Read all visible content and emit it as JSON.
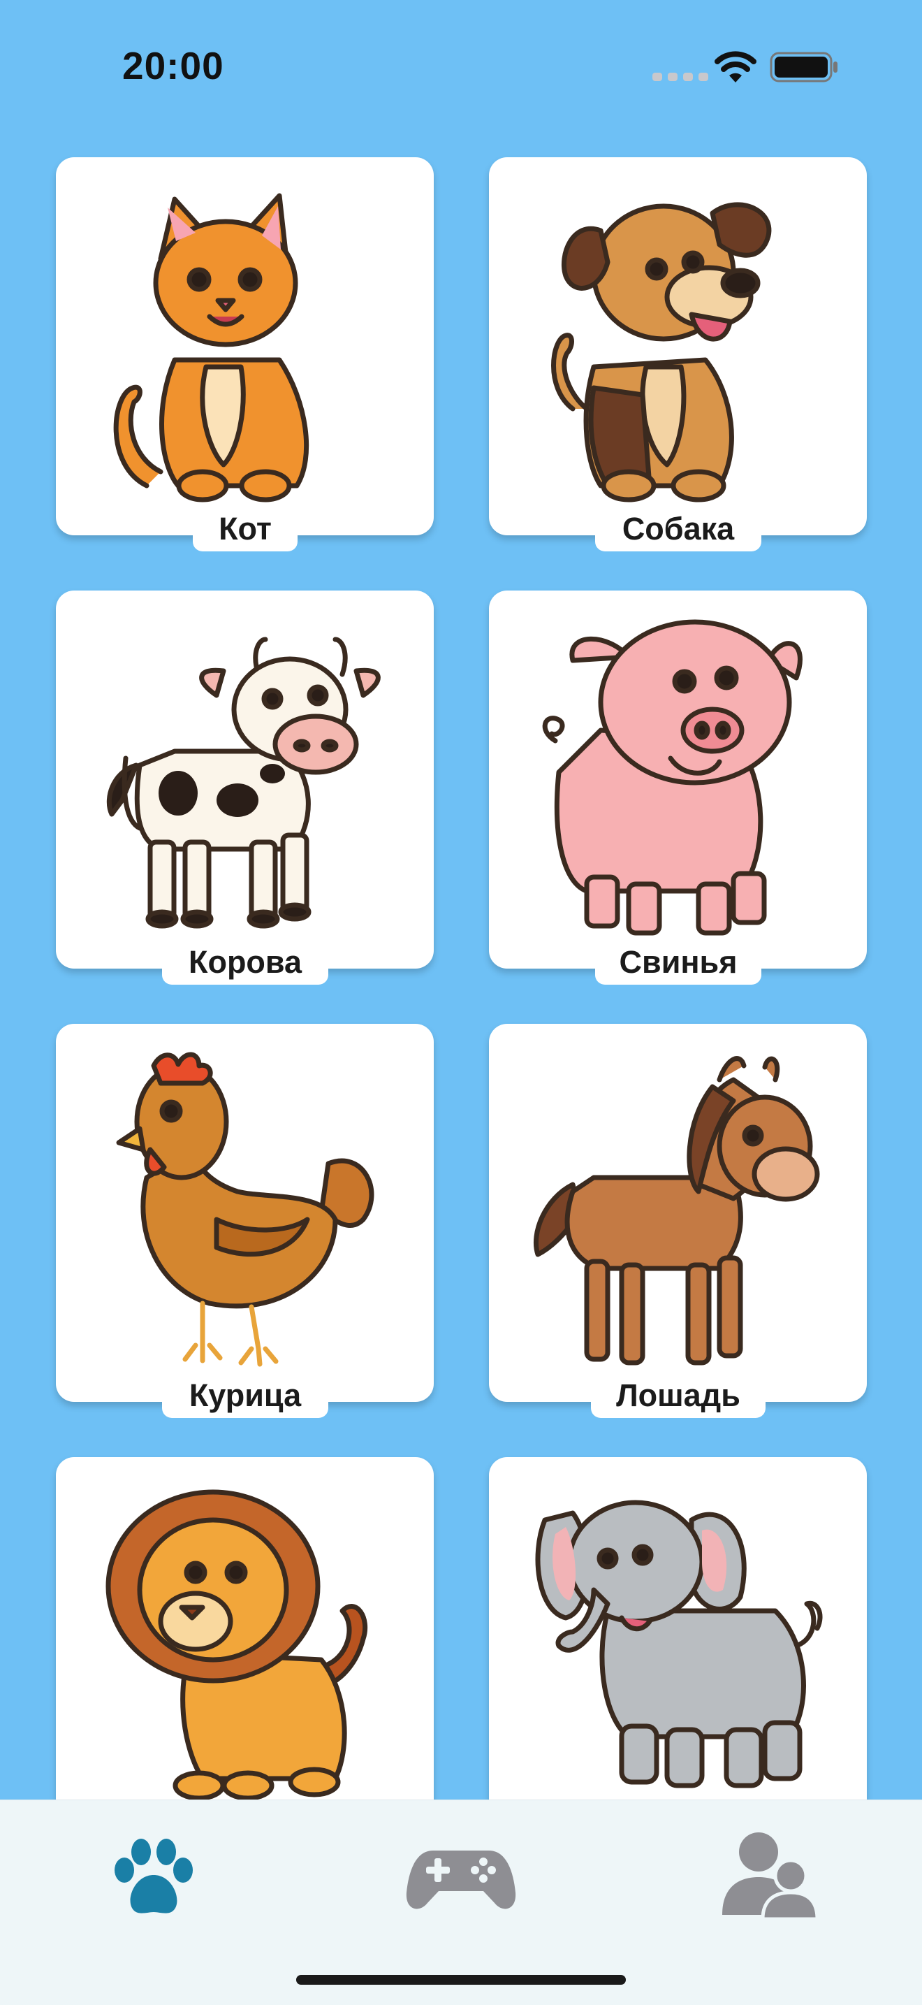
{
  "status_bar": {
    "time": "20:00",
    "icons": [
      "cellular-signal-icon",
      "wifi-icon",
      "battery-icon"
    ]
  },
  "animals": [
    {
      "name": "Кот",
      "icon": "cat-icon"
    },
    {
      "name": "Собака",
      "icon": "dog-icon"
    },
    {
      "name": "Корова",
      "icon": "cow-icon"
    },
    {
      "name": "Свинья",
      "icon": "pig-icon"
    },
    {
      "name": "Курица",
      "icon": "chicken-icon"
    },
    {
      "name": "Лошадь",
      "icon": "horse-icon"
    },
    {
      "name": "",
      "icon": "lion-icon"
    },
    {
      "name": "",
      "icon": "elephant-icon"
    }
  ],
  "tab_bar": {
    "tabs": [
      {
        "id": "animals",
        "icon": "paw-icon",
        "selected": true
      },
      {
        "id": "games",
        "icon": "gamepad-icon",
        "selected": false
      },
      {
        "id": "profile",
        "icon": "users-icon",
        "selected": false
      }
    ]
  },
  "colors": {
    "background": "#6EC0F5",
    "card": "#FFFFFF",
    "tab_bar": "#EEF6F8",
    "tab_active": "#1A7FA6",
    "tab_inactive": "#8E8E93"
  }
}
